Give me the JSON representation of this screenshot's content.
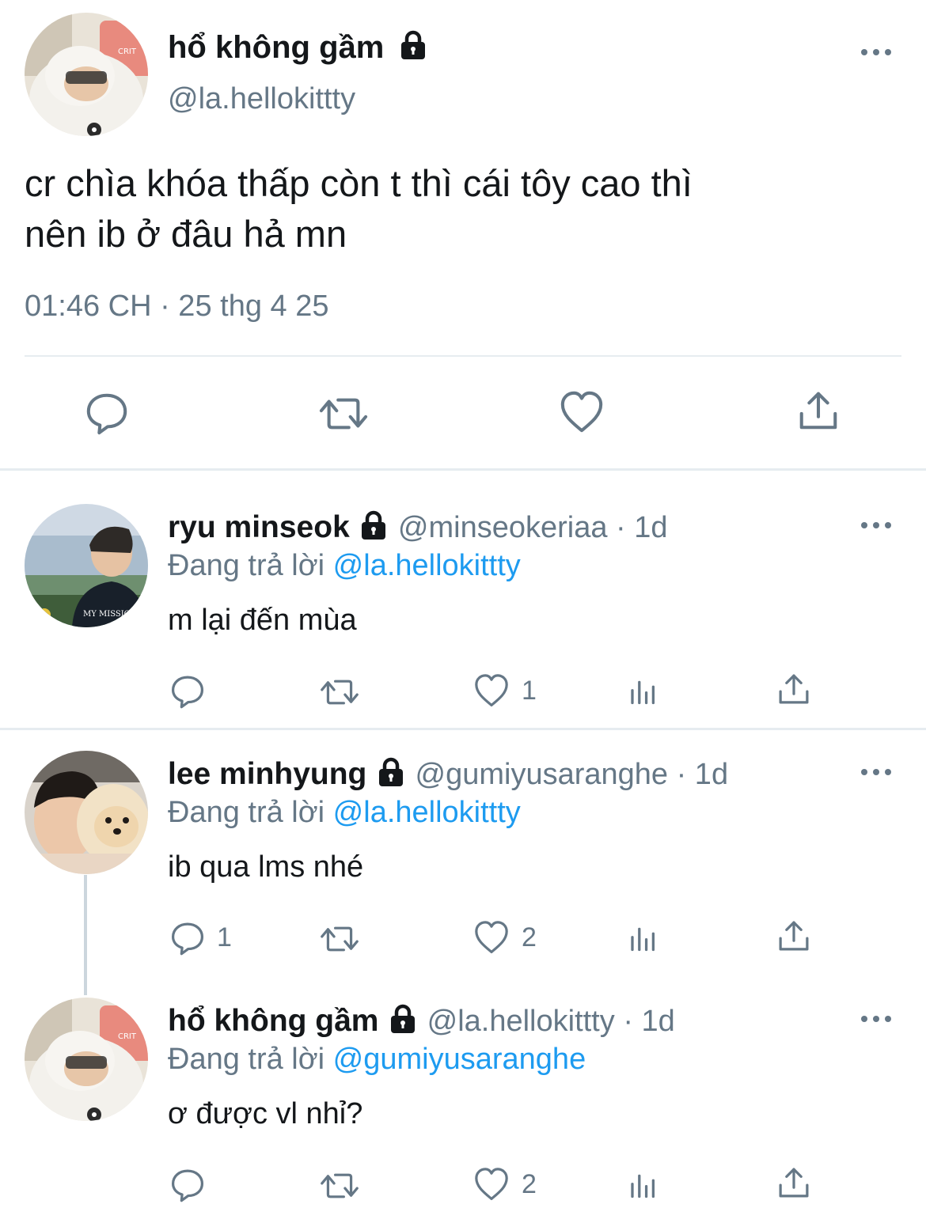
{
  "main_tweet": {
    "author_name": "hổ không gầm",
    "author_handle": "@la.hellokittty",
    "text_line1": "cr chìa khóa thấp còn t thì cái tôy cao thì",
    "text_line2": "nên ib ở đâu hả mn",
    "timestamp": "01:46 CH · 25 thg 4 25"
  },
  "replies": [
    {
      "author_name": "ryu minseok",
      "author_handle": "@minseokeriaa",
      "age": "· 1d",
      "replying_label": "Đang trả lời",
      "replying_to": "@la.hellokittty",
      "text": "m lại đến mùa",
      "reply_count": "",
      "like_count": "1"
    },
    {
      "author_name": "lee minhyung",
      "author_handle": "@gumiyusaranghe",
      "age": "· 1d",
      "replying_label": "Đang trả lời",
      "replying_to": "@la.hellokittty",
      "text": "ib qua lms nhé",
      "reply_count": "1",
      "like_count": "2"
    },
    {
      "author_name": "hổ không gầm",
      "author_handle": "@la.hellokittty",
      "age": "· 1d",
      "replying_label": "Đang trả lời",
      "replying_to": "@gumiyusaranghe",
      "text": "ơ được vl nhỉ?",
      "reply_count": "",
      "like_count": "2"
    }
  ],
  "colors": {
    "link": "#1d9bf0",
    "muted": "#657786",
    "divider": "#e6ecf0"
  },
  "icons": [
    "lock-icon",
    "more-icon",
    "reply-icon",
    "retweet-icon",
    "like-icon",
    "share-icon",
    "analytics-icon"
  ]
}
